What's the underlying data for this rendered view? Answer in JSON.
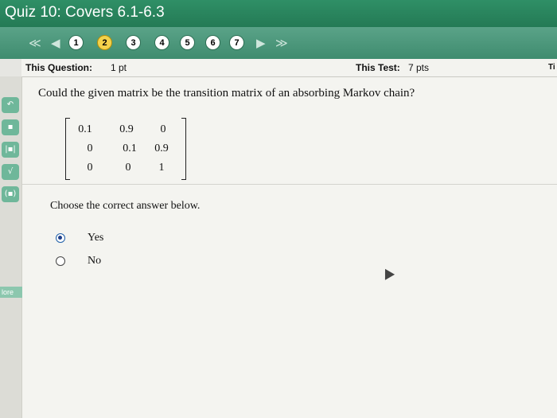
{
  "window": {
    "title": "Quiz 10: Covers 6.1-6.3"
  },
  "nav": {
    "first": "≪",
    "prev": "◀",
    "next": "▶",
    "last": "≫",
    "questions": [
      "1",
      "2",
      "3",
      "4",
      "5",
      "6",
      "7"
    ],
    "current_index": 1
  },
  "info": {
    "question_label": "This Question:",
    "question_points": "1 pt",
    "test_label": "This Test:",
    "test_points": "7 pts",
    "time_label": "Ti"
  },
  "tools": {
    "more_label": "lore"
  },
  "question": {
    "text": "Could the given matrix be the transition matrix of an absorbing Markov chain?",
    "matrix": [
      [
        "0.1",
        "0.9",
        "0"
      ],
      [
        "0",
        "0.1",
        "0.9"
      ],
      [
        "0",
        "0",
        "1"
      ]
    ],
    "prompt": "Choose the correct answer below.",
    "options": [
      {
        "label": "Yes",
        "selected": true
      },
      {
        "label": "No",
        "selected": false
      }
    ]
  }
}
